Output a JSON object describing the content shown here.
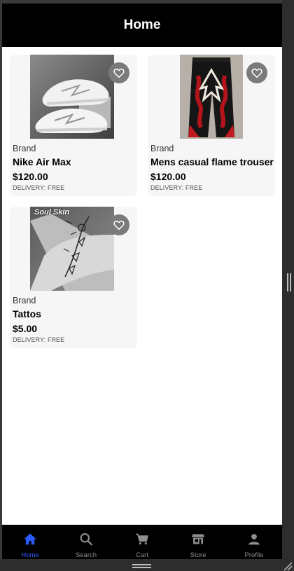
{
  "header": {
    "title": "Home"
  },
  "products": [
    {
      "brand": "Brand",
      "name": "Nike Air Max",
      "price": "$120.00",
      "delivery": "DELIVERY: FREE",
      "image": "white-sneakers-photo",
      "favorite_icon": "heart-outline-icon"
    },
    {
      "brand": "Brand",
      "name": "Mens casual flame trouser",
      "price": "$120.00",
      "delivery": "DELIVERY: FREE",
      "image": "black-flame-trousers-photo",
      "favorite_icon": "heart-outline-icon"
    },
    {
      "brand": "Brand",
      "name": "Tattos",
      "price": "$5.00",
      "delivery": "DELIVERY: FREE",
      "image": "arm-tattoo-photo",
      "image_caption": "Soul Skin",
      "favorite_icon": "heart-outline-icon"
    }
  ],
  "tabbar": {
    "items": [
      {
        "label": "Home",
        "icon": "home-icon",
        "active": true
      },
      {
        "label": "Search",
        "icon": "search-icon",
        "active": false
      },
      {
        "label": "Cart",
        "icon": "cart-icon",
        "active": false
      },
      {
        "label": "Store",
        "icon": "store-icon",
        "active": false
      },
      {
        "label": "Profile",
        "icon": "profile-icon",
        "active": false
      }
    ]
  },
  "colors": {
    "header_bg": "#000000",
    "active_tab": "#2a5bff",
    "inactive_tab": "#8e8e8e",
    "card_bg": "#f6f6f6",
    "favorite_button": "#7a7a7a"
  }
}
